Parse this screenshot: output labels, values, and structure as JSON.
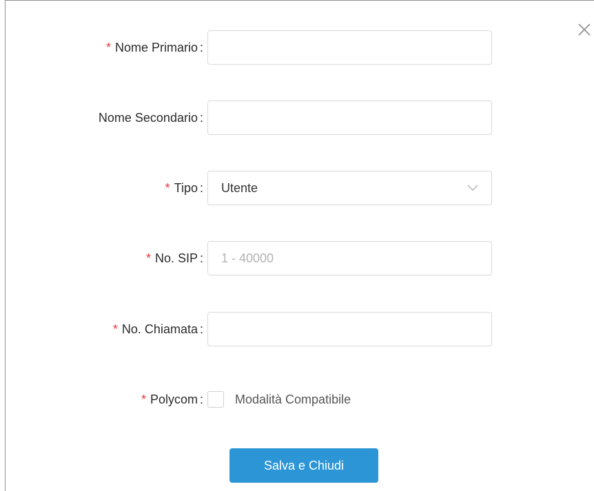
{
  "form": {
    "primary_name": {
      "required_mark": "*",
      "label": "Nome Primario",
      "colon": ":",
      "value": "",
      "placeholder": ""
    },
    "secondary_name": {
      "label": "Nome Secondario",
      "colon": ":",
      "value": "",
      "placeholder": ""
    },
    "type": {
      "required_mark": "*",
      "label": "Tipo",
      "colon": ":",
      "selected": "Utente",
      "icon": "chevron-down-icon"
    },
    "sip_number": {
      "required_mark": "*",
      "label": "No. SIP",
      "colon": ":",
      "value": "",
      "placeholder": "1 - 40000"
    },
    "call_number": {
      "required_mark": "*",
      "label": "No. Chiamata",
      "colon": ":",
      "value": "",
      "placeholder": ""
    },
    "polycom": {
      "required_mark": "*",
      "label": "Polycom",
      "colon": ":",
      "checkbox_label": "Modalità Compatibile",
      "checked": false
    }
  },
  "actions": {
    "save_label": "Salva e Chiudi"
  },
  "icons": {
    "close": "close-icon"
  },
  "colors": {
    "accent": "#2b95d6",
    "required": "#e8363b",
    "border": "#d9d9d9"
  }
}
